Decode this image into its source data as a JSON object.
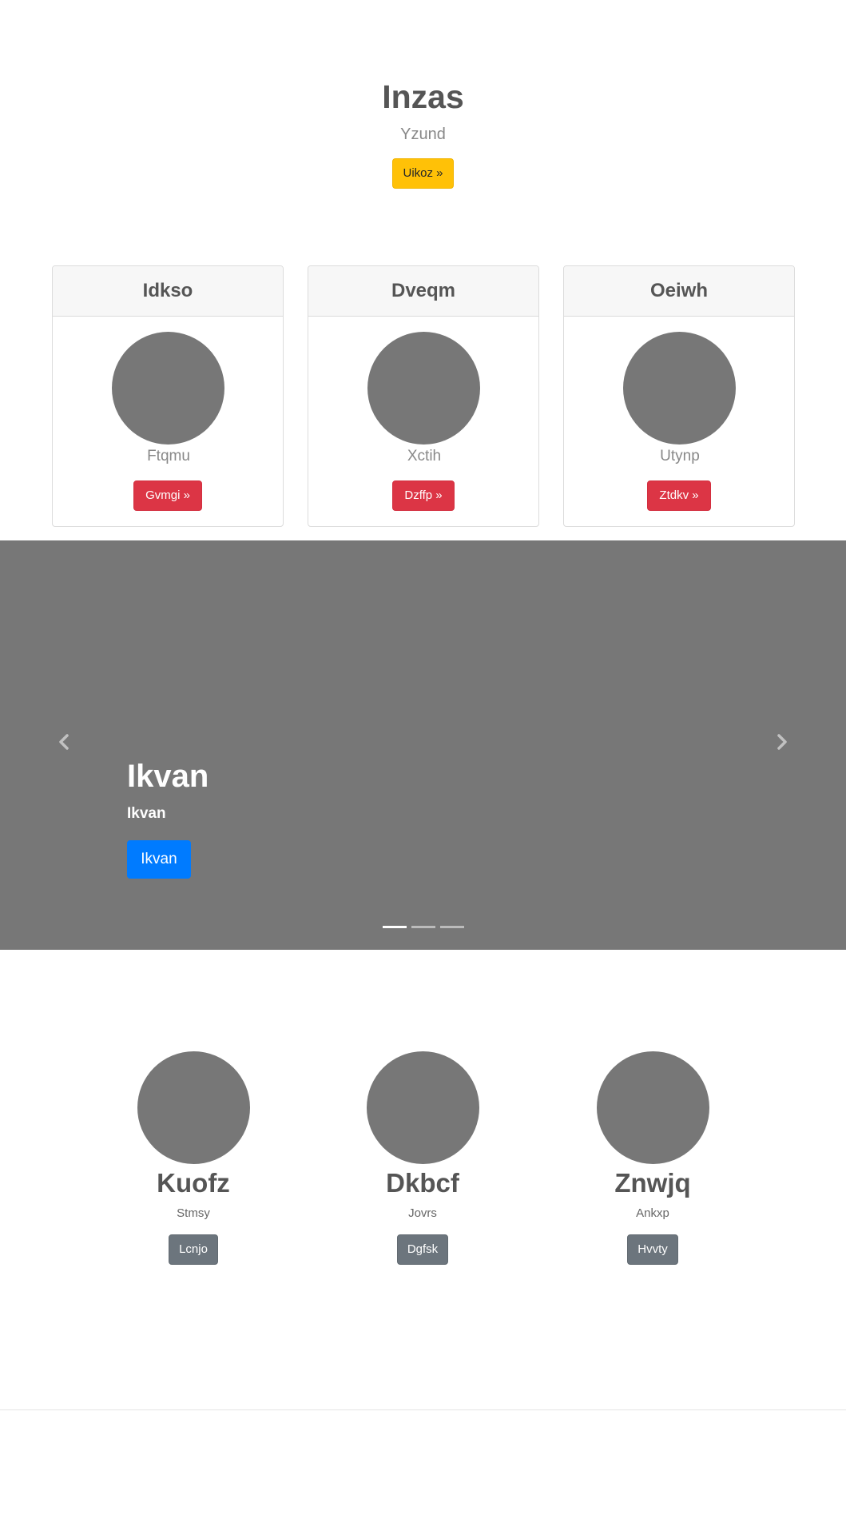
{
  "hero": {
    "title": "Inzas",
    "subtitle": "Yzund",
    "button_label": "Uikoz »"
  },
  "cards": [
    {
      "header": "Idkso",
      "text": "Ftqmu",
      "button_label": "Gvmgi »"
    },
    {
      "header": "Dveqm",
      "text": "Xctih",
      "button_label": "Dzffp »"
    },
    {
      "header": "Oeiwh",
      "text": "Utynp",
      "button_label": "Ztdkv »"
    }
  ],
  "carousel": {
    "title": "Ikvan",
    "subtitle": "Ikvan",
    "button_label": "Ikvan",
    "slide_count": 3,
    "active_slide": 1,
    "prev_icon": "chevron-left-icon",
    "next_icon": "chevron-right-icon"
  },
  "features": [
    {
      "title": "Kuofz",
      "text": "Stmsy",
      "button_label": "Lcnjo"
    },
    {
      "title": "Dkbcf",
      "text": "Jovrs",
      "button_label": "Dgfsk"
    },
    {
      "title": "Znwjq",
      "text": "Ankxp",
      "button_label": "Hvvty"
    }
  ],
  "colors": {
    "hero_button": "#ffc107",
    "card_button": "#dc3545",
    "carousel_bg": "#777777",
    "carousel_button": "#007bff",
    "feature_button": "#6c757d",
    "placeholder": "#777777"
  }
}
